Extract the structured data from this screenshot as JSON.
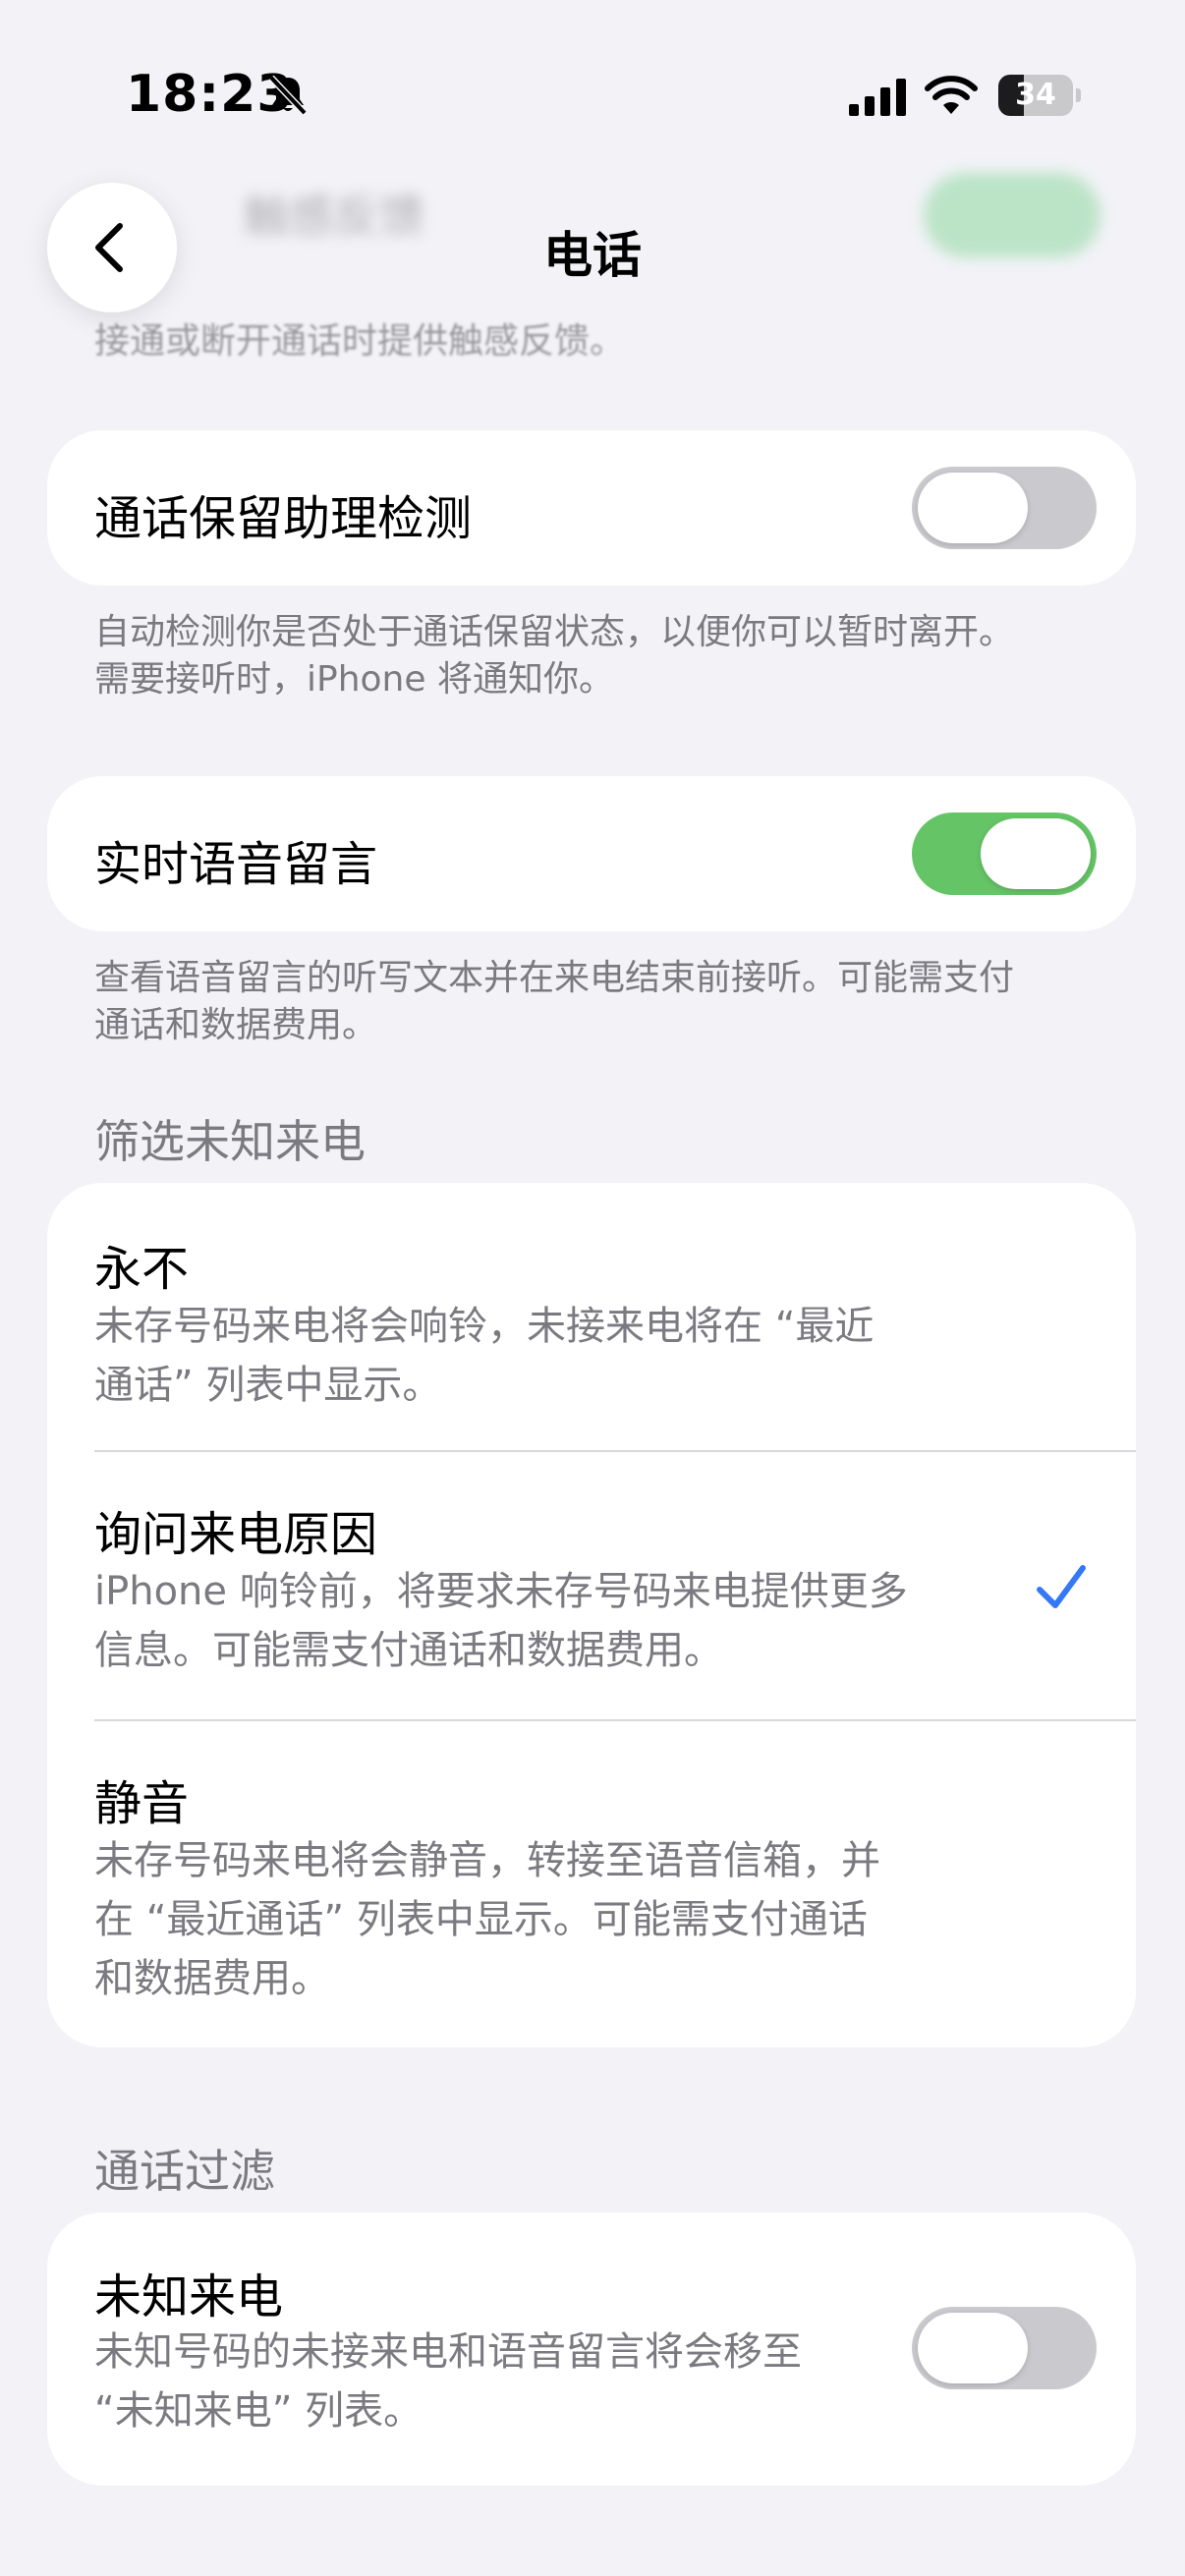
{
  "status_bar": {
    "time": "18:23",
    "battery_level": "34",
    "battery_fraction": 0.34
  },
  "ghost": {
    "row_text": "触感反馈",
    "caption": "接通或断开通话时提供触感反馈。"
  },
  "nav": {
    "title": "电话",
    "back_icon": "chevron-left-icon"
  },
  "hold_assist": {
    "label": "通话保留助理检测",
    "enabled": false,
    "footnote_lines": [
      "自动检测你是否处于通话保留状态，以便你可以暂时离开。",
      "需要接听时，iPhone 将通知你。"
    ]
  },
  "live_voicemail": {
    "label": "实时语音留言",
    "enabled": true,
    "footnote_lines": [
      "查看语音留言的听写文本并在来电结束前接听。可能需支付",
      "通话和数据费用。"
    ]
  },
  "screen_unknown": {
    "header": "筛选未知来电",
    "options": [
      {
        "title": "永不",
        "desc_lines": [
          "未存号码来电将会响铃，未接来电将在 “最近",
          "通话” 列表中显示。"
        ],
        "selected": false
      },
      {
        "title": "询问来电原因",
        "desc_lines": [
          "iPhone 响铃前，将要求未存号码来电提供更多",
          "信息。可能需支付通话和数据费用。"
        ],
        "selected": true
      },
      {
        "title": "静音",
        "desc_lines": [
          "未存号码来电将会静音，转接至语音信箱，并",
          "在 “最近通话” 列表中显示。可能需支付通话",
          "和数据费用。"
        ],
        "selected": false
      }
    ]
  },
  "call_filtering": {
    "header": "通话过滤",
    "label": "未知来电",
    "desc_lines": [
      "未知号码的未接来电和语音留言将会移至",
      "“未知来电” 列表。"
    ],
    "enabled": false
  },
  "colors": {
    "accent": "#3478f6",
    "toggle_on": "#65c466",
    "toggle_off": "#c9c9ce",
    "background": "#f2f2f7"
  }
}
